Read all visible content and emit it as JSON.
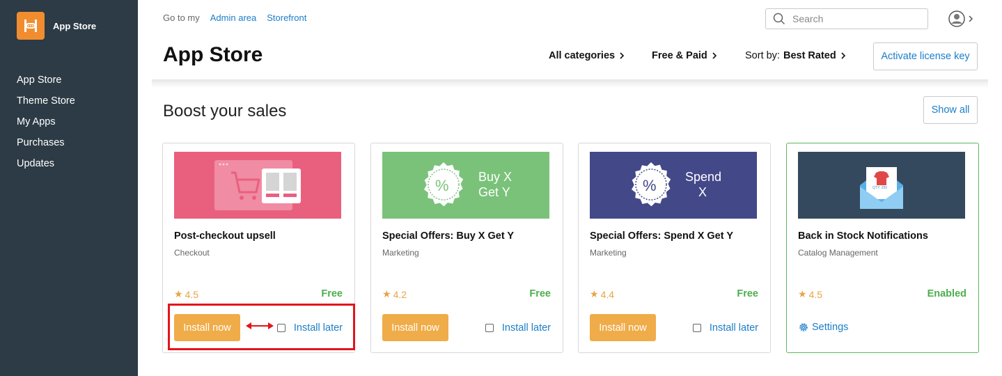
{
  "sidebar": {
    "brand": "App Store",
    "items": [
      {
        "label": "App Store"
      },
      {
        "label": "Theme Store"
      },
      {
        "label": "My Apps"
      },
      {
        "label": "Purchases"
      },
      {
        "label": "Updates"
      }
    ]
  },
  "topbar": {
    "goto_label": "Go to my",
    "admin_link": "Admin area",
    "storefront_link": "Storefront",
    "search_placeholder": "Search"
  },
  "header": {
    "title": "App Store",
    "filter_categories": "All categories",
    "filter_price": "Free & Paid",
    "sort_label": "Sort by:",
    "sort_value": "Best Rated",
    "activate_button": "Activate license key"
  },
  "section": {
    "title": "Boost your sales",
    "show_all": "Show all"
  },
  "cards": [
    {
      "title": "Post-checkout upsell",
      "category": "Checkout",
      "rating": "4.5",
      "price": "Free",
      "install": "Install now",
      "later": "Install later"
    },
    {
      "title": "Special Offers: Buy X Get Y",
      "category": "Marketing",
      "rating": "4.2",
      "price": "Free",
      "install": "Install now",
      "later": "Install later",
      "banner_line1": "Buy X",
      "banner_line2": "Get Y",
      "banner_symbol": "%"
    },
    {
      "title": "Special Offers: Spend X Get Y",
      "category": "Marketing",
      "rating": "4.4",
      "price": "Free",
      "install": "Install now",
      "later": "Install later",
      "banner_line1": "Spend",
      "banner_line2": "X",
      "banner_symbol": "%"
    },
    {
      "title": "Back in Stock Notifications",
      "category": "Catalog Management",
      "rating": "4.5",
      "price": "Enabled",
      "settings": "Settings",
      "banner_qty": "QTY: 250"
    }
  ],
  "colors": {
    "sidebar_bg": "#2c3b45",
    "brand_orange": "#f18d2f",
    "link_blue": "#1b7ec9",
    "install_orange": "#f0ac49",
    "success_green": "#4cae4c",
    "highlight_red": "#e3141b",
    "card1_banner": "#e9607f",
    "card2_banner": "#7ac27a",
    "card3_banner": "#434889",
    "card4_banner": "#34495e"
  }
}
